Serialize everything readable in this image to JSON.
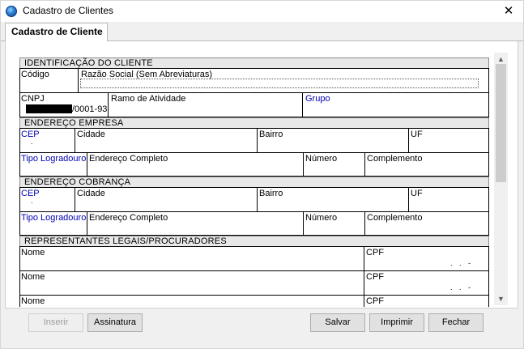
{
  "window": {
    "title": "Cadastro de Clientes",
    "close_glyph": "✕"
  },
  "tabs": [
    {
      "label": "Cadastro de Cliente"
    }
  ],
  "sections": {
    "identificacao": "IDENTIFICAÇÃO DO CLIENTE",
    "endereco_empresa": "ENDEREÇO EMPRESA",
    "endereco_cobranca": "ENDEREÇO COBRANÇA",
    "representantes": "REPRESENTANTES LEGAIS/PROCURADORES"
  },
  "fields": {
    "codigo": "Código",
    "razao_social": "Razão Social (Sem Abreviaturas)",
    "cnpj": "CNPJ",
    "cnpj_value": "/0001-93",
    "ramo": "Ramo de Atividade",
    "grupo": "Grupo",
    "cep": "CEP",
    "cep_mask": ".",
    "cidade": "Cidade",
    "bairro": "Bairro",
    "uf": "UF",
    "tipo_logradouro": "Tipo Logradouro",
    "endereco_completo": "Endereço Completo",
    "numero": "Número",
    "complemento": "Complemento",
    "nome": "Nome",
    "cpf": "CPF",
    "cpf_mask": ". . -"
  },
  "buttons": {
    "inserir": "Inserir",
    "assinatura": "Assinatura",
    "salvar": "Salvar",
    "imprimir": "Imprimir",
    "fechar": "Fechar"
  },
  "icons": {
    "app": "app-globe-icon",
    "close": "close-icon",
    "scroll_up": "scroll-up-arrow-icon",
    "scroll_down": "scroll-down-arrow-icon"
  }
}
